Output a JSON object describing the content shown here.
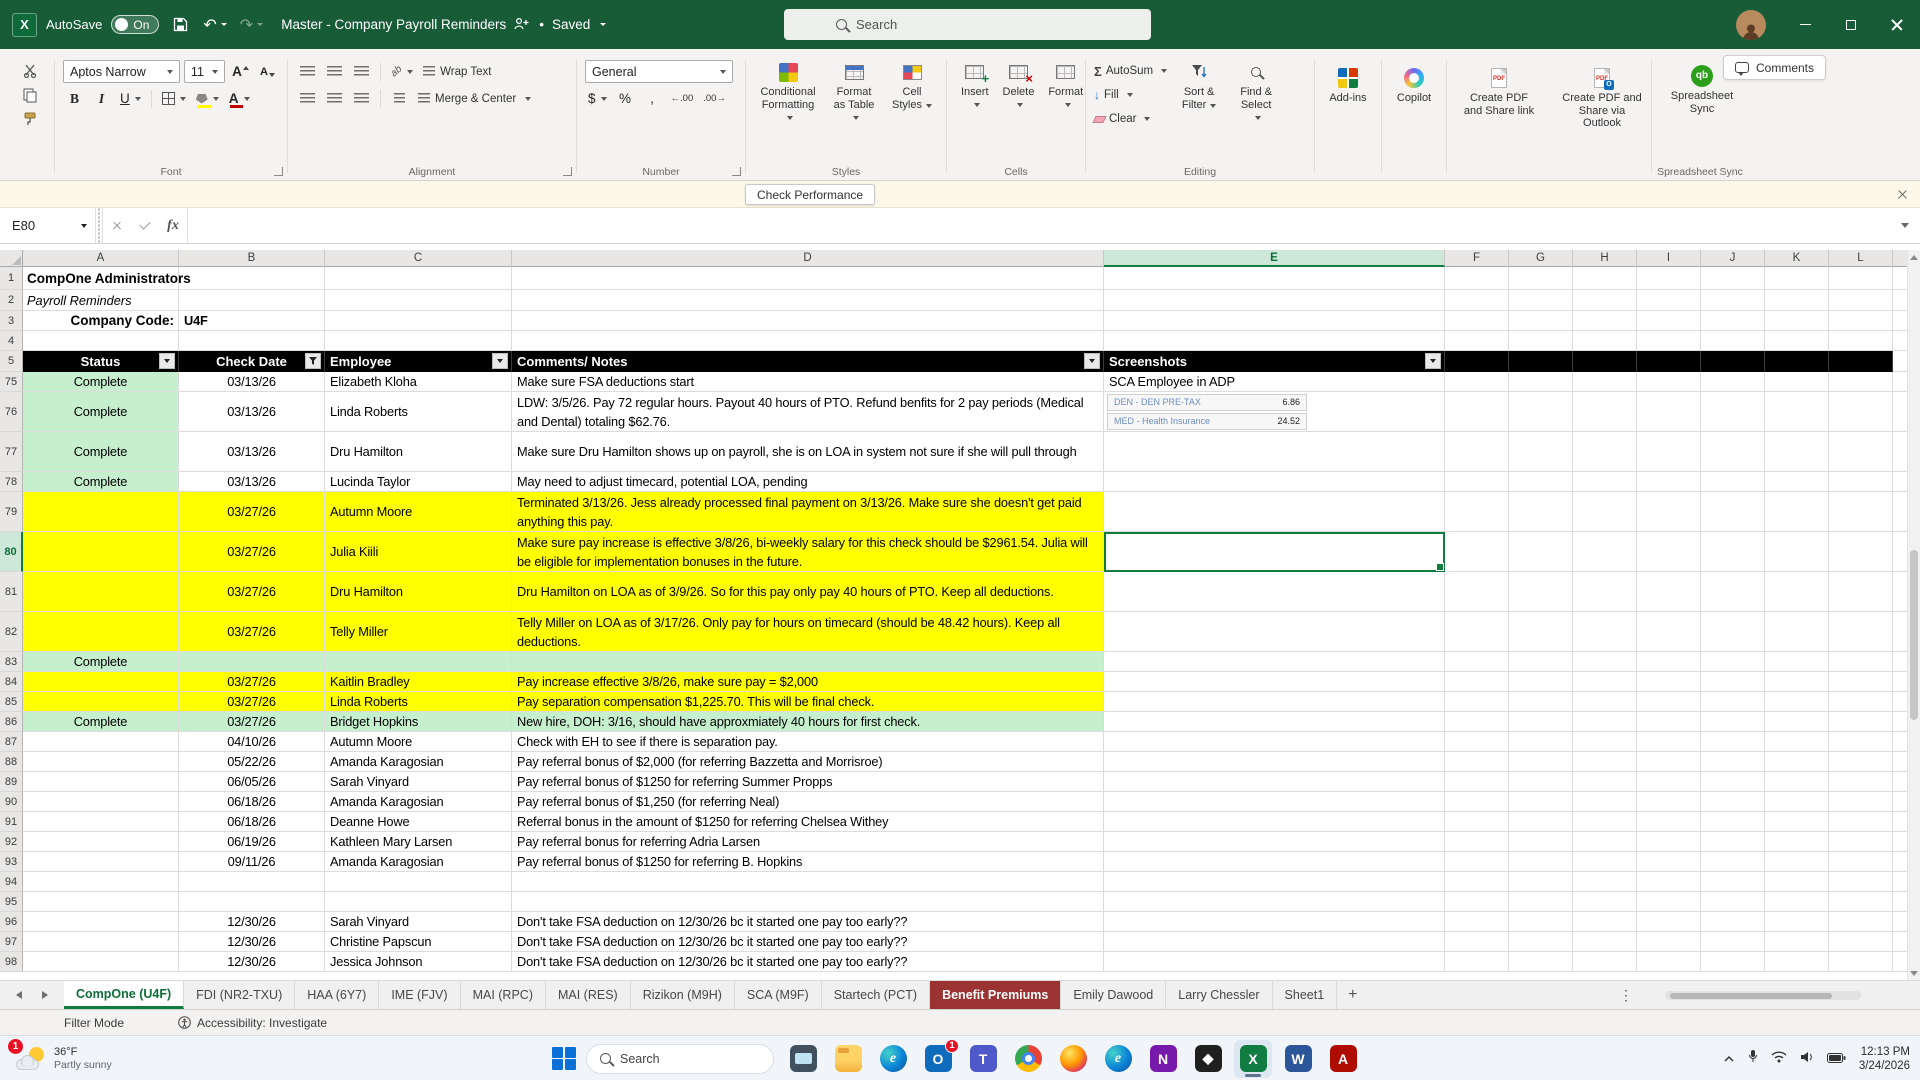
{
  "titlebar": {
    "app": "Excel",
    "autosave_label": "AutoSave",
    "autosave_state": "On",
    "doc_title": "Master - Company Payroll Reminders",
    "dot": "•",
    "saved_status": "Saved",
    "search_placeholder": "Search",
    "comments_label": "Comments"
  },
  "message_bar": {
    "button_label": "Check Performance"
  },
  "formula_bar": {
    "name_box": "E80",
    "fx_label": "fx",
    "formula_value": ""
  },
  "ribbon": {
    "font_name": "Aptos Narrow",
    "font_size": "11",
    "bold": "B",
    "italic": "I",
    "underline": "U",
    "wrap_text": "Wrap Text",
    "merge_center": "Merge & Center",
    "number_format": "General",
    "currency": "$",
    "percent": "%",
    "comma": ",",
    "conditional_formatting": "Conditional Formatting",
    "format_as_table": "Format as Table",
    "cell_styles": "Cell Styles",
    "insert": "Insert",
    "delete": "Delete",
    "format": "Format",
    "autosum": "AutoSum",
    "fill": "Fill",
    "clear": "Clear",
    "sort_filter": "Sort & Filter",
    "find_select": "Find & Select",
    "addins": "Add-ins",
    "copilot": "Copilot",
    "pdf_share_link": "Create PDF and Share link",
    "pdf_share_outlook": "Create PDF and Share via Outlook",
    "spreadsheet_sync": "Spreadsheet Sync",
    "group_labels": {
      "font": "Font",
      "alignment": "Alignment",
      "number": "Number",
      "styles": "Styles",
      "cells": "Cells",
      "editing": "Editing",
      "spreadsheet_sync": "Spreadsheet Sync"
    }
  },
  "grid": {
    "columns": [
      "A",
      "B",
      "C",
      "D",
      "E",
      "F",
      "G",
      "H",
      "I",
      "J",
      "K",
      "L"
    ],
    "selected_column": "E",
    "selected_row": 80,
    "selected_cell": "E80",
    "top_rows": [
      {
        "n": 1,
        "a": "CompOne Administrators",
        "style": "bold"
      },
      {
        "n": 2,
        "a": "Payroll Reminders",
        "style": "italic"
      },
      {
        "n": 3,
        "a": "Company Code:",
        "b": "U4F",
        "style": "bold"
      },
      {
        "n": 4,
        "a": ""
      }
    ],
    "header_row": {
      "n": 5,
      "status": "Status",
      "check_date": "Check Date",
      "employee": "Employee",
      "notes": "Comments/ Notes",
      "screenshots": "Screenshots"
    },
    "screenshot_snips": [
      {
        "label": "DEN - DEN PRE-TAX",
        "value": "6.86"
      },
      {
        "label": "MED - Health Insurance",
        "value": "24.52"
      }
    ],
    "rows": [
      {
        "n": 75,
        "status": "Complete",
        "date": "03/13/26",
        "employee": "Elizabeth Kloha",
        "notes": "Make sure FSA deductions start",
        "fill": "complete",
        "e_text": "SCA Employee in ADP"
      },
      {
        "n": 76,
        "status": "Complete",
        "date": "03/13/26",
        "employee": "Linda Roberts",
        "notes": "LDW: 3/5/26. Pay 72 regular hours. Payout 40 hours of PTO. Refund benfits for 2 pay periods (Medical and Dental) totaling $62.76.",
        "fill": "complete",
        "tall": true,
        "e_shots": true
      },
      {
        "n": 77,
        "status": "Complete",
        "date": "03/13/26",
        "employee": "Dru Hamilton",
        "notes": "Make sure Dru Hamilton shows up on payroll, she is on LOA in system not sure if she will pull through",
        "fill": "complete",
        "tall": true
      },
      {
        "n": 78,
        "status": "Complete",
        "date": "03/13/26",
        "employee": "Lucinda Taylor",
        "notes": "May need to adjust timecard, potential LOA, pending",
        "fill": "complete"
      },
      {
        "n": 79,
        "status": "",
        "date": "03/27/26",
        "employee": "Autumn Moore",
        "notes": "Terminated 3/13/26. Jess already processed final payment on 3/13/26. Make sure she doesn't get paid anything this pay.",
        "fill": "yellow",
        "tall": true
      },
      {
        "n": 80,
        "status": "",
        "date": "03/27/26",
        "employee": "Julia Kiili",
        "notes": "Make sure pay increase is effective 3/8/26, bi-weekly salary for this check should be $2961.54. Julia will be eligible for implementation bonuses in the future.",
        "fill": "yellow",
        "tall": true
      },
      {
        "n": 81,
        "status": "",
        "date": "03/27/26",
        "employee": "Dru Hamilton",
        "notes": "Dru Hamilton on LOA as of 3/9/26. So for this pay only pay 40 hours of PTO. Keep all deductions.",
        "fill": "yellow",
        "tall": true
      },
      {
        "n": 82,
        "status": "",
        "date": "03/27/26",
        "employee": "Telly Miller",
        "notes": "Telly Miller on LOA as of 3/17/26. Only pay for hours on timecard (should be 48.42 hours). Keep all deductions.",
        "fill": "yellow",
        "tall": true
      },
      {
        "n": 83,
        "status": "Complete",
        "date": "",
        "employee": "",
        "notes": "",
        "fill": "rowgreen"
      },
      {
        "n": 84,
        "status": "",
        "date": "03/27/26",
        "employee": "Kaitlin Bradley",
        "notes": "Pay increase effective 3/8/26, make sure pay = $2,000",
        "fill": "yellow"
      },
      {
        "n": 85,
        "status": "",
        "date": "03/27/26",
        "employee": "Linda Roberts",
        "notes": "Pay separation compensation $1,225.70. This will be final check.",
        "fill": "yellow"
      },
      {
        "n": 86,
        "status": "Complete",
        "date": "03/27/26",
        "employee": "Bridget Hopkins",
        "notes": "New hire, DOH: 3/16, should have approxmiately 40 hours for first check.",
        "fill": "rowgreen"
      },
      {
        "n": 87,
        "status": "",
        "date": "04/10/26",
        "employee": "Autumn Moore",
        "notes": "Check with EH to see if there is separation pay.",
        "fill": ""
      },
      {
        "n": 88,
        "status": "",
        "date": "05/22/26",
        "employee": "Amanda Karagosian",
        "notes": "Pay referral bonus of $2,000 (for referring Bazzetta and Morrisroe)",
        "fill": ""
      },
      {
        "n": 89,
        "status": "",
        "date": "06/05/26",
        "employee": "Sarah Vinyard",
        "notes": "Pay referral bonus of $1250 for referring Summer Propps",
        "fill": ""
      },
      {
        "n": 90,
        "status": "",
        "date": "06/18/26",
        "employee": "Amanda Karagosian",
        "notes": "Pay referral bonus of $1,250 (for referring Neal)",
        "fill": ""
      },
      {
        "n": 91,
        "status": "",
        "date": "06/18/26",
        "employee": "Deanne Howe",
        "notes": "Referral bonus in the amount of $1250 for referring Chelsea Withey",
        "fill": ""
      },
      {
        "n": 92,
        "status": "",
        "date": "06/19/26",
        "employee": "Kathleen Mary Larsen",
        "notes": "Pay referral bonus for referring Adria Larsen",
        "fill": ""
      },
      {
        "n": 93,
        "status": "",
        "date": "09/11/26",
        "employee": "Amanda Karagosian",
        "notes": "Pay referral bonus of $1250 for referring B. Hopkins",
        "fill": ""
      },
      {
        "n": 94,
        "status": "",
        "date": "",
        "employee": "",
        "notes": "",
        "fill": ""
      },
      {
        "n": 95,
        "status": "",
        "date": "",
        "employee": "",
        "notes": "",
        "fill": ""
      },
      {
        "n": 96,
        "status": "",
        "date": "12/30/26",
        "employee": "Sarah Vinyard",
        "notes": "Don't take FSA deduction on 12/30/26 bc it started one pay too early??",
        "fill": ""
      },
      {
        "n": 97,
        "status": "",
        "date": "12/30/26",
        "employee": "Christine Papscun",
        "notes": "Don't take FSA deduction on 12/30/26 bc it started one pay too early??",
        "fill": ""
      },
      {
        "n": 98,
        "status": "",
        "date": "12/30/26",
        "employee": "Jessica Johnson",
        "notes": "Don't take FSA deduction on 12/30/26 bc it started one pay too early??",
        "fill": ""
      }
    ]
  },
  "sheet_tabs": [
    {
      "label": "CompOne (U4F)",
      "active": true
    },
    {
      "label": "FDI (NR2-TXU)"
    },
    {
      "label": "HAA (6Y7)"
    },
    {
      "label": "IME (FJV)"
    },
    {
      "label": "MAI (RPC)"
    },
    {
      "label": "MAI (RES)"
    },
    {
      "label": "Rizikon (M9H)"
    },
    {
      "label": "SCA (M9F)"
    },
    {
      "label": "Startech (PCT)"
    },
    {
      "label": "Benefit Premiums",
      "color": "#9B3332"
    },
    {
      "label": "Emily Dawood"
    },
    {
      "label": "Larry Chessler"
    },
    {
      "label": "Sheet1"
    }
  ],
  "status_bar": {
    "mode": "Filter Mode",
    "accessibility": "Accessibility: Investigate"
  },
  "taskbar": {
    "weather": {
      "temp": "36°F",
      "condition": "Partly sunny",
      "badge": "1"
    },
    "search_label": "Search",
    "apps": [
      {
        "name": "task-view",
        "cls": "monitor"
      },
      {
        "name": "file-explorer",
        "cls": "folder"
      },
      {
        "name": "edge",
        "cls": "edge",
        "glyph": "e"
      },
      {
        "name": "outlook",
        "bg": "#0F6CBD",
        "glyph": "O",
        "badge": "1"
      },
      {
        "name": "teams",
        "bg": "#5059C9",
        "glyph": "T"
      },
      {
        "name": "chrome",
        "cls": "chrome"
      },
      {
        "name": "firefox",
        "cls": "firefox"
      },
      {
        "name": "edge-2",
        "cls": "edge",
        "glyph": "e"
      },
      {
        "name": "onenote",
        "bg": "#7719AA",
        "glyph": "N"
      },
      {
        "name": "dark-app",
        "bg": "#1F1F1F",
        "glyph": "◆"
      },
      {
        "name": "excel",
        "bg": "#107C41",
        "glyph": "X",
        "active": true
      },
      {
        "name": "word",
        "bg": "#2B579A",
        "glyph": "W"
      },
      {
        "name": "acrobat",
        "bg": "#AE0C00",
        "glyph": "A"
      }
    ],
    "clock": {
      "time": "12:13 PM",
      "date": "3/24/2026"
    }
  },
  "colors": {
    "titlebar_green": "#185C37",
    "accent_green": "#107C41",
    "highlight_yellow": "#FFFF00",
    "complete_green": "#C6EFCE",
    "header_black": "#000000",
    "tab_red": "#9B3332"
  }
}
